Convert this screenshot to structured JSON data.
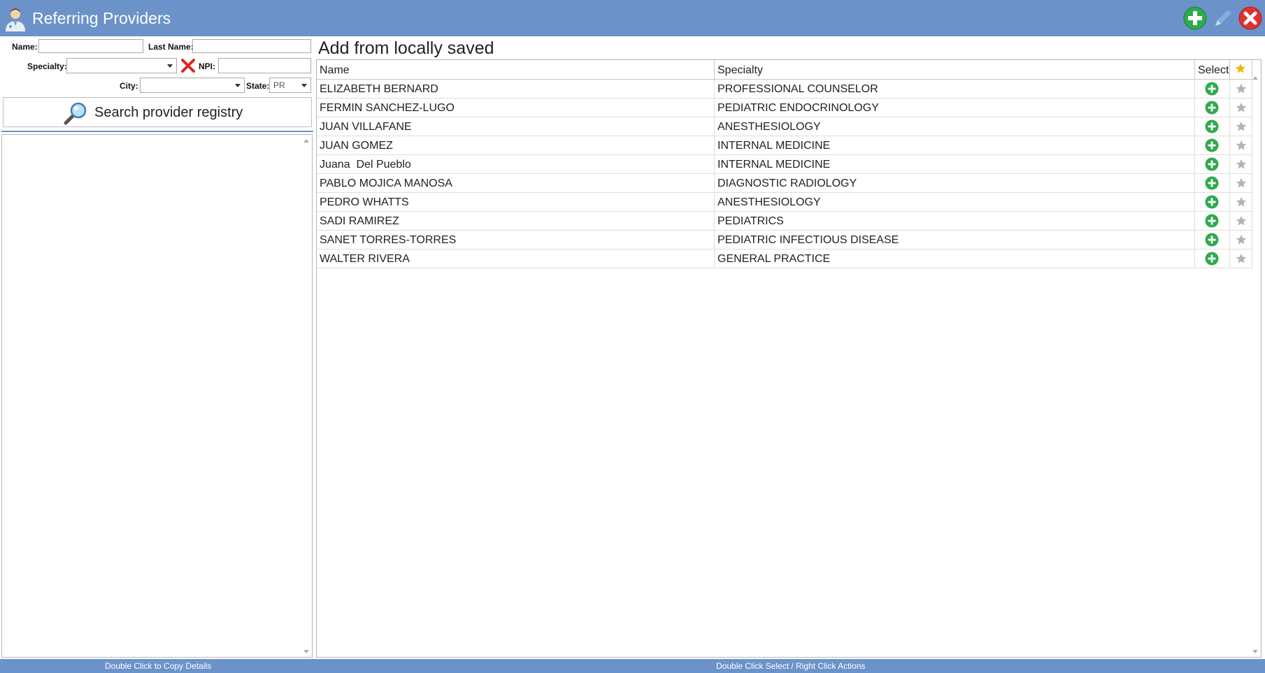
{
  "window": {
    "title": "Referring Providers"
  },
  "search_form": {
    "name_label": "Name:",
    "name_value": "",
    "last_name_label": "Last Name:",
    "last_name_value": "",
    "specialty_label": "Specialty:",
    "specialty_value": "",
    "npi_label": "NPI:",
    "npi_value": "",
    "city_label": "City:",
    "city_value": "",
    "state_label": "State:",
    "state_value": "PR",
    "search_button_label": "Search provider registry"
  },
  "local": {
    "title": "Add from locally saved",
    "columns": {
      "name": "Name",
      "specialty": "Specialty",
      "select": "Select"
    },
    "rows": [
      {
        "name": "ELIZABETH BERNARD",
        "specialty": "PROFESSIONAL COUNSELOR"
      },
      {
        "name": "FERMIN SANCHEZ-LUGO",
        "specialty": "PEDIATRIC ENDOCRINOLOGY"
      },
      {
        "name": "JUAN VILLAFANE",
        "specialty": "ANESTHESIOLOGY"
      },
      {
        "name": "JUAN GOMEZ",
        "specialty": "INTERNAL MEDICINE"
      },
      {
        "name": "Juana  Del Pueblo",
        "specialty": "INTERNAL MEDICINE"
      },
      {
        "name": "PABLO MOJICA MANOSA",
        "specialty": "DIAGNOSTIC RADIOLOGY"
      },
      {
        "name": "PEDRO WHATTS",
        "specialty": "ANESTHESIOLOGY"
      },
      {
        "name": "SADI RAMIREZ",
        "specialty": "PEDIATRICS"
      },
      {
        "name": "SANET TORRES-TORRES",
        "specialty": "PEDIATRIC INFECTIOUS DISEASE"
      },
      {
        "name": "WALTER RIVERA",
        "specialty": "GENERAL PRACTICE"
      }
    ]
  },
  "status": {
    "left": "Double Click to Copy Details",
    "right": "Double Click Select / Right Click Actions"
  },
  "icons": {
    "app": "doctor-icon",
    "add": "add-icon",
    "edit": "pencil-icon",
    "close": "close-icon",
    "search": "magnifier-icon",
    "clear": "clear-x-icon",
    "select": "plus-circle-icon",
    "favorite": "star-icon"
  },
  "colors": {
    "titlebar": "#6c93c9",
    "add_green": "#2faa4f",
    "close_red": "#e03030",
    "favorite_gold": "#f2b705",
    "favorite_gray": "#b3b3b3"
  }
}
